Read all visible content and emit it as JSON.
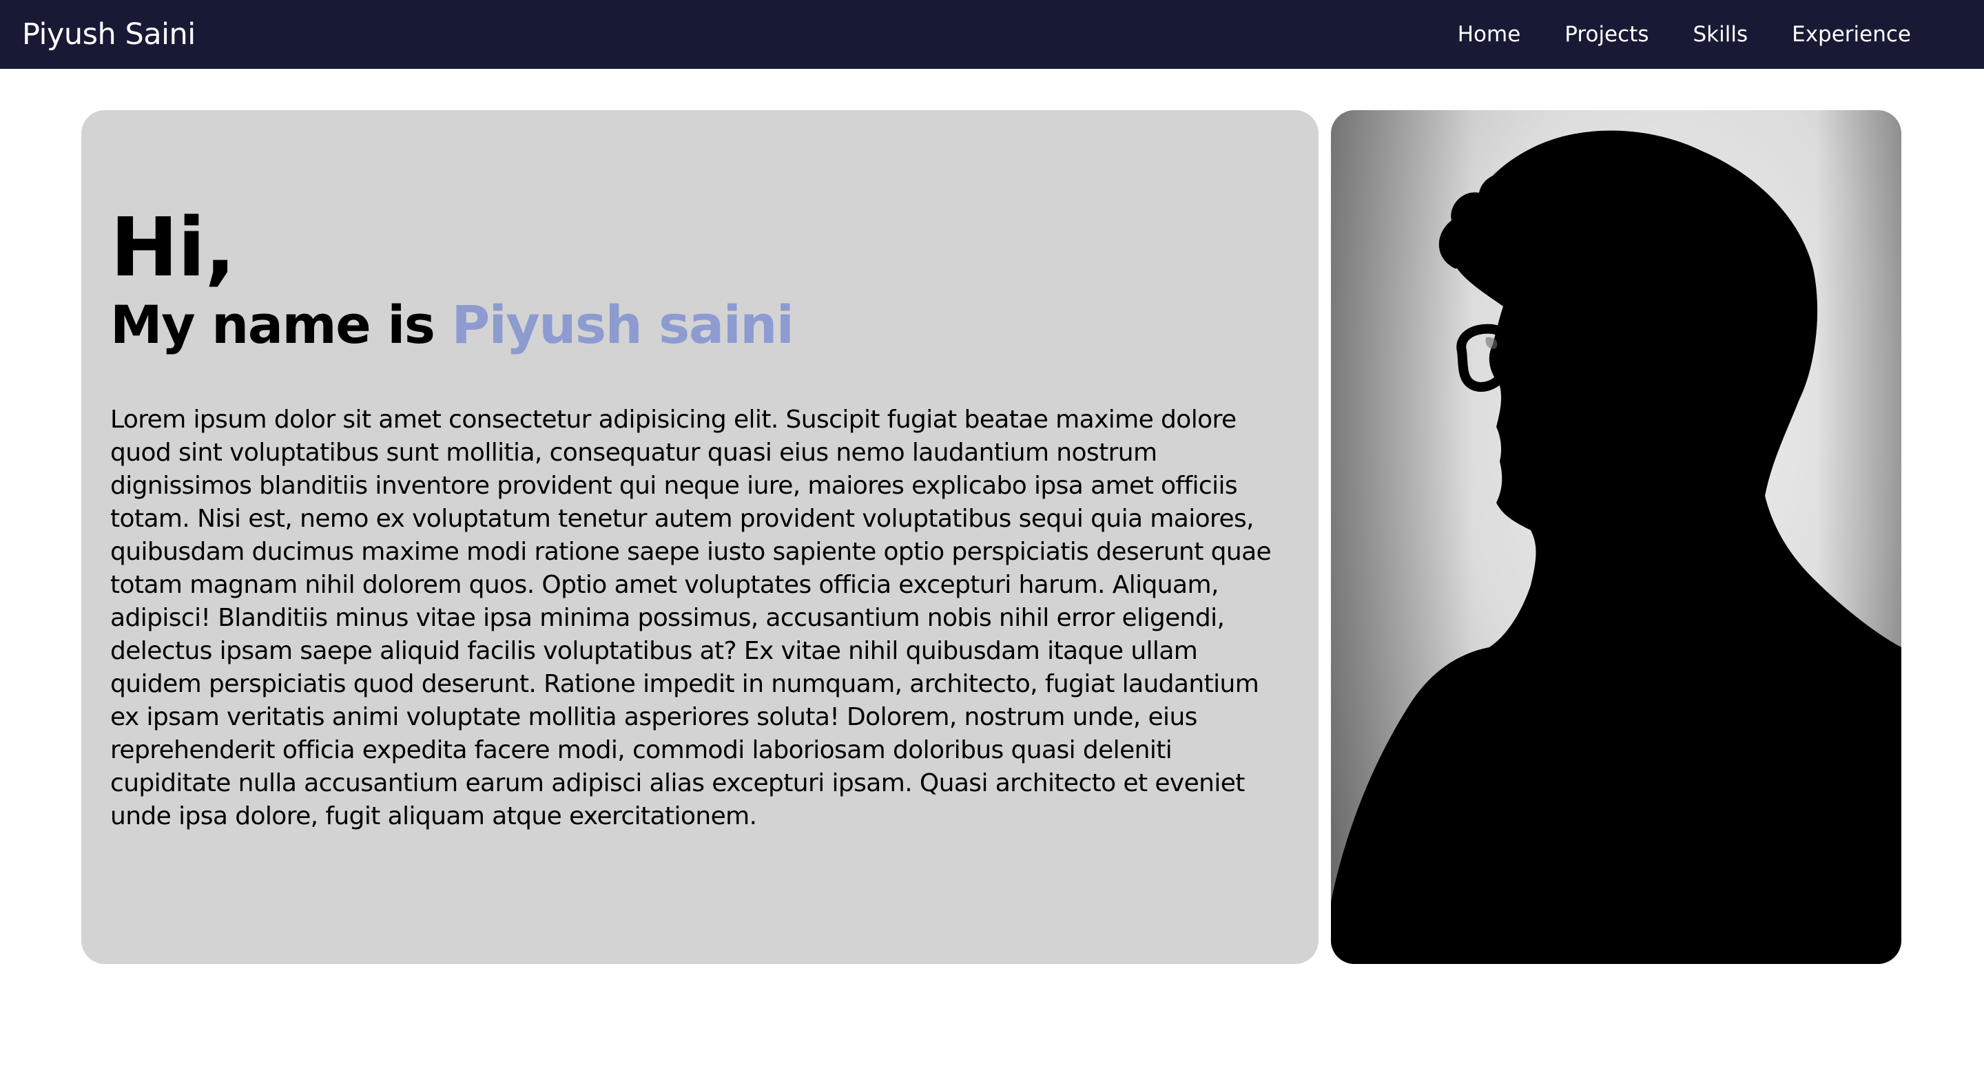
{
  "navbar": {
    "brand": "Piyush Saini",
    "links": [
      "Home",
      "Projects",
      "Skills",
      "Experience"
    ],
    "background": "#181a35"
  },
  "intro": {
    "greeting": "Hi,",
    "name_prefix": "My name is",
    "name": "Piyush saini",
    "name_color": "#8d9bd1",
    "paragraph": "Lorem ipsum dolor sit amet consectetur adipisicing elit. Suscipit fugiat beatae maxime dolore quod sint voluptatibus sunt mollitia, consequatur quasi eius nemo laudantium nostrum dignissimos blanditiis inventore provident qui neque iure, maiores explicabo ipsa amet officiis totam. Nisi est, nemo ex voluptatum tenetur autem provident voluptatibus sequi quia maiores, quibusdam ducimus maxime modi ratione saepe iusto sapiente optio perspiciatis deserunt quae totam magnam nihil dolorem quos. Optio amet voluptates officia excepturi harum. Aliquam, adipisci! Blanditiis minus vitae ipsa minima possimus, accusantium nobis nihil error eligendi, delectus ipsam saepe aliquid facilis voluptatibus at? Ex vitae nihil quibusdam itaque ullam quidem perspiciatis quod deserunt. Ratione impedit in numquam, architecto, fugiat laudantium ex ipsam veritatis animi voluptate mollitia asperiores soluta! Dolorem, nostrum unde, eius reprehenderit officia expedita facere modi, commodi laboriosam doloribus quasi deleniti cupiditate nulla accusantium earum adipisci alias excepturi ipsam. Quasi architecto et eveniet unde ipsa dolore, fugit aliquam atque exercitationem.",
    "card_color": "#d3d3d3"
  },
  "photo": {
    "icon": "silhouette-portrait"
  }
}
